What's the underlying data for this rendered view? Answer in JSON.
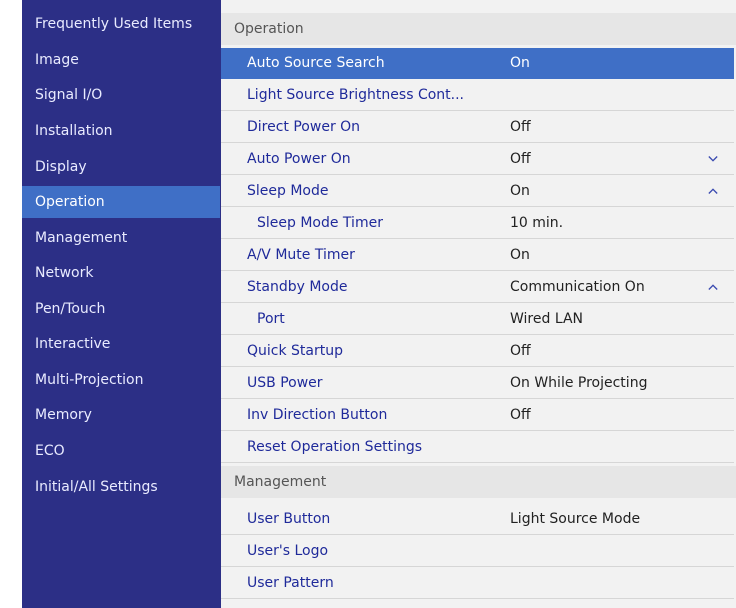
{
  "sidebar": {
    "items": [
      {
        "label": "Frequently Used Items"
      },
      {
        "label": "Image"
      },
      {
        "label": "Signal I/O"
      },
      {
        "label": "Installation"
      },
      {
        "label": "Display"
      },
      {
        "label": "Operation",
        "active": true
      },
      {
        "label": "Management"
      },
      {
        "label": "Network"
      },
      {
        "label": "Pen/Touch"
      },
      {
        "label": "Interactive"
      },
      {
        "label": "Multi-Projection"
      },
      {
        "label": "Memory"
      },
      {
        "label": "ECO"
      },
      {
        "label": "Initial/All Settings"
      }
    ]
  },
  "main": {
    "operation_header": "Operation",
    "operation_rows": [
      {
        "label": "Auto Source Search",
        "value": "On",
        "selected": true
      },
      {
        "label": "Light Source Brightness Cont...",
        "value": ""
      },
      {
        "label": "Direct Power On",
        "value": "Off"
      },
      {
        "label": "Auto Power On",
        "value": "Off",
        "chevron": "chevron-down-icon"
      },
      {
        "label": "Sleep Mode",
        "value": "On",
        "chevron": "chevron-up-icon"
      },
      {
        "label": "Sleep Mode Timer",
        "value": "10 min.",
        "indent": true
      },
      {
        "label": "A/V Mute Timer",
        "value": "On"
      },
      {
        "label": "Standby Mode",
        "value": "Communication On",
        "chevron": "chevron-up-icon"
      },
      {
        "label": "Port",
        "value": "Wired LAN",
        "indent": true
      },
      {
        "label": "Quick Startup",
        "value": "Off"
      },
      {
        "label": "USB Power",
        "value": "On While Projecting"
      },
      {
        "label": "Inv Direction Button",
        "value": "Off"
      },
      {
        "label": "Reset Operation Settings",
        "value": ""
      }
    ],
    "management_header": "Management",
    "management_rows": [
      {
        "label": "User Button",
        "value": "Light Source Mode"
      },
      {
        "label": "User's Logo",
        "value": ""
      },
      {
        "label": "User Pattern",
        "value": ""
      }
    ]
  },
  "colors": {
    "sidebar_bg": "#2c2f86",
    "selection": "#3f6fc6",
    "label_text": "#1f2a9a",
    "panel_bg": "#f2f2f2"
  }
}
